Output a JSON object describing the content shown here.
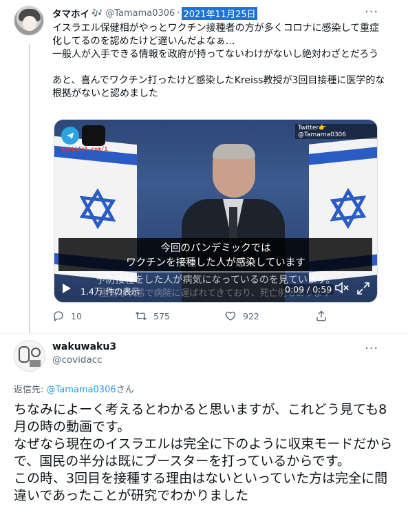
{
  "tweet1": {
    "name": "タマホイ",
    "name_emoji": "🎶",
    "handle": "@Tamama0306",
    "separator": "·",
    "date": "2021年11月25日",
    "more_label": "···",
    "paragraphs": [
      "イスラエル保健相がやっとワクチン接種者の方が多くコロナに感染して重症化してるのを認めたけど遅いんだよなぁ…",
      "一般人が入手できる情報を政府が持ってないわけがないし絶対わざとだろう",
      "あと、喜んでワクチン打ったけど感染したKreiss教授が3回目接種に医学的な根拠がないと認めました"
    ],
    "video": {
      "watermark": "Twitter👉@Tamama0306",
      "logo_text": "hattifot.com/1",
      "subtitle_line1": "今回のパンデミックでは",
      "subtitle_line2": "ワクチンを接種した人が感染しています",
      "subtitle_line3": "予防接種をした人が病気になっているのを見ています。",
      "subtitle_line4": "重篤な状態で病院に運ばれてきており、死亡例もあります",
      "views": "1.4万 件の表示",
      "time": "0:09 / 0:59",
      "progress": 0.15
    },
    "actions": {
      "replies": "10",
      "retweets": "575",
      "likes": "922"
    }
  },
  "tweet2": {
    "name": "wakuwaku3",
    "handle": "@covidacc",
    "more_label": "···",
    "replying_prefix": "返信先: ",
    "replying_mention": "@Tamama0306",
    "replying_suffix": "さん",
    "paragraphs": [
      "ちなみによーく考えるとわかると思いますが、これどう見ても8月の時の動画です。",
      "なぜなら現在のイスラエルは完全に下のように収束モードだからで、国民の半分は既にブースターを打っているからです。",
      "この時、3回目を接種する理由はないといっていた方は完全に間違いであったことが研究でわかりました"
    ]
  },
  "colors": {
    "accent": "#1d9bf0",
    "date_highlight": "#1d73d6",
    "muted": "#536471"
  }
}
